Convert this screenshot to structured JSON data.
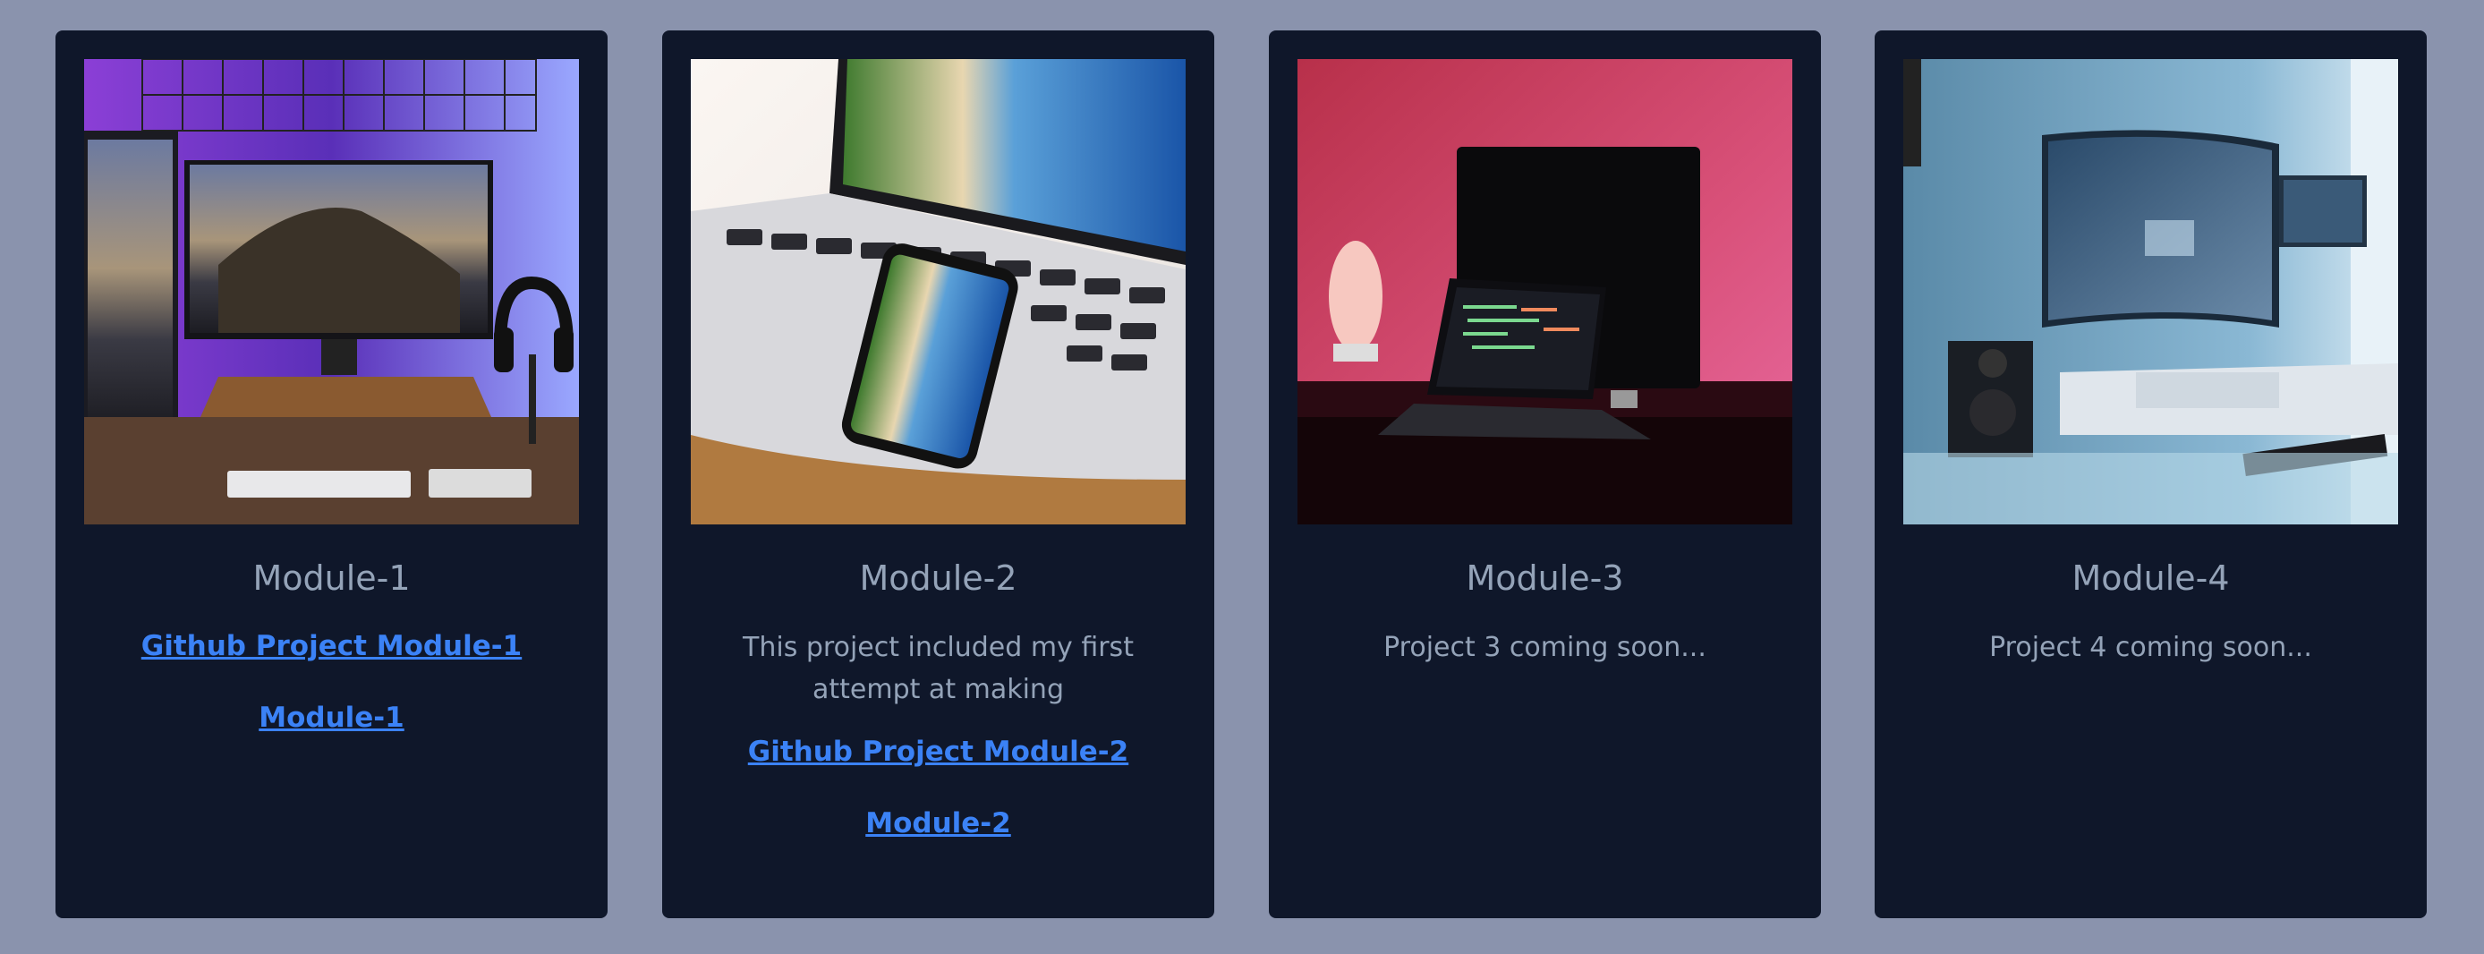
{
  "cards": [
    {
      "title": "Module-1",
      "links": [
        "Github Project Module-1",
        "Module-1"
      ],
      "image": "desk-setup-purple-photo"
    },
    {
      "title": "Module-2",
      "description": "This project included my first attempt at making",
      "links": [
        "Github Project Module-2",
        "Module-2"
      ],
      "image": "laptop-phone-beach-photo"
    },
    {
      "title": "Module-3",
      "description": "Project 3 coming soon...",
      "image": "laptop-pink-light-photo"
    },
    {
      "title": "Module-4",
      "description": "Project 4 coming soon...",
      "image": "blue-monitor-setup-photo"
    }
  ],
  "colors": {
    "page_background": "#8a93ad",
    "card_background": "#0f172a",
    "title_text": "#94a3b8",
    "link": "#3b82f6"
  }
}
